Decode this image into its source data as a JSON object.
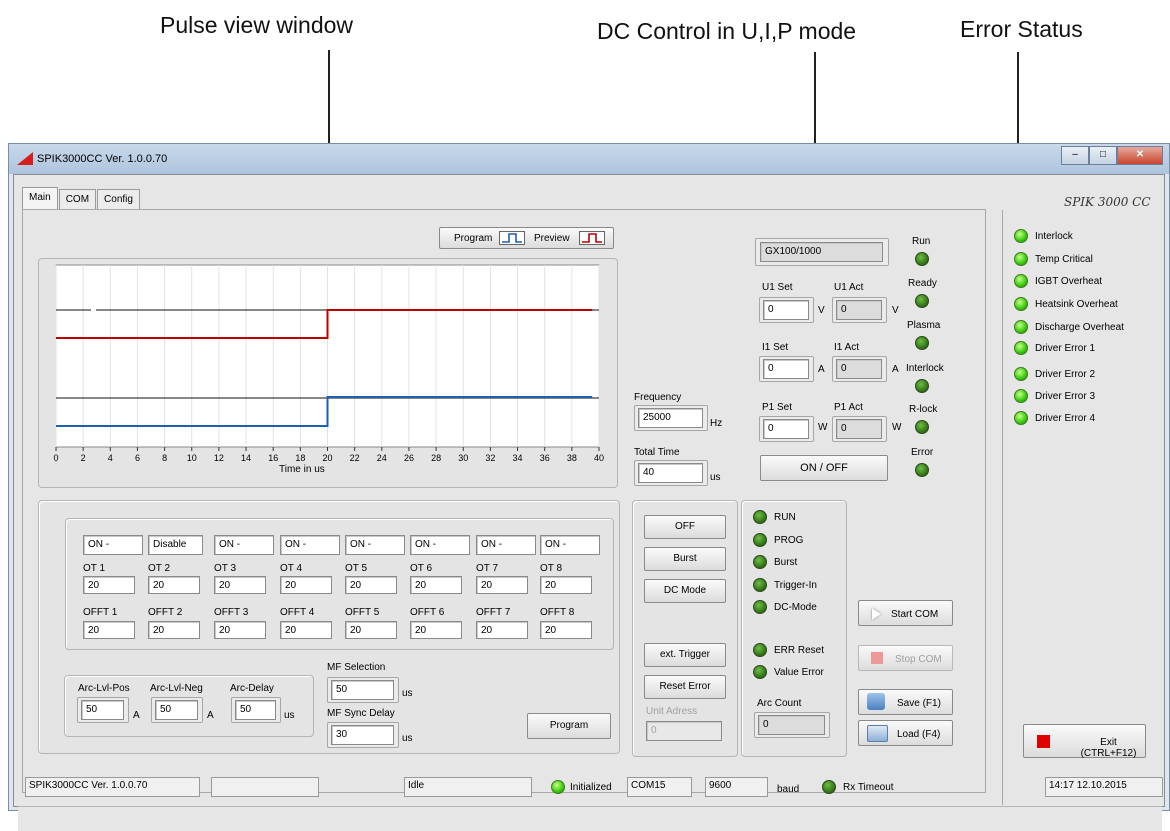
{
  "callouts": {
    "pulse": "Pulse view window",
    "dc": "DC Control in U,I,P mode",
    "error": "Error Status"
  },
  "window": {
    "title": "SPIK3000CC Ver. 1.0.0.70",
    "brand": "SPIK 3000 CC"
  },
  "tabs": [
    "Main",
    "COM",
    "Config"
  ],
  "legend": {
    "program": "Program",
    "preview": "Preview"
  },
  "chart_data": {
    "type": "line",
    "xlabel": "Time in us",
    "xlim": [
      0,
      40
    ],
    "xticks": [
      0,
      2,
      4,
      6,
      8,
      10,
      12,
      14,
      16,
      18,
      20,
      22,
      24,
      26,
      28,
      30,
      32,
      34,
      36,
      38,
      40
    ],
    "series": [
      {
        "name": "Program",
        "color": "#c00000",
        "x": [
          0,
          20,
          20,
          39.5
        ],
        "y": [
          0,
          0,
          1,
          1
        ]
      },
      {
        "name": "Program",
        "color": "#1f5fb0",
        "x": [
          0,
          20,
          20,
          39.5
        ],
        "y": [
          0,
          0,
          1,
          1
        ]
      }
    ]
  },
  "frequency": {
    "label": "Frequency",
    "value": "25000",
    "unit": "Hz"
  },
  "total_time": {
    "label": "Total Time",
    "value": "40",
    "unit": "us"
  },
  "ot_table": {
    "modes": [
      "ON -",
      "Disable",
      "ON -",
      "ON -",
      "ON -",
      "ON -",
      "ON -",
      "ON -"
    ],
    "ot_labels": [
      "OT 1",
      "OT 2",
      "OT 3",
      "OT 4",
      "OT 5",
      "OT 6",
      "OT 7",
      "OT 8"
    ],
    "ot_values": [
      "20",
      "20",
      "20",
      "20",
      "20",
      "20",
      "20",
      "20"
    ],
    "offt_labels": [
      "OFFT 1",
      "OFFT 2",
      "OFFT 3",
      "OFFT 4",
      "OFFT 5",
      "OFFT 6",
      "OFFT 7",
      "OFFT 8"
    ],
    "offt_values": [
      "20",
      "20",
      "20",
      "20",
      "20",
      "20",
      "20",
      "20"
    ]
  },
  "arc": {
    "pos_label": "Arc-Lvl-Pos",
    "pos_value": "50",
    "pos_unit": "A",
    "neg_label": "Arc-Lvl-Neg",
    "neg_value": "50",
    "neg_unit": "A",
    "delay_label": "Arc-Delay",
    "delay_value": "50",
    "delay_unit": "us"
  },
  "mf": {
    "sel_label": "MF Selection",
    "sel_value": "50",
    "sel_unit": "us",
    "sync_label": "MF Sync Delay",
    "sync_value": "30",
    "sync_unit": "us"
  },
  "program_button": "Program",
  "mode_buttons": {
    "off": "OFF",
    "burst": "Burst",
    "dc": "DC Mode",
    "ext": "ext. Trigger",
    "reset": "Reset Error"
  },
  "unit_address": {
    "label": "Unit Adress",
    "value": "0"
  },
  "dc": {
    "model": "GX100/1000",
    "u1_set": "U1 Set",
    "u1_act": "U1 Act",
    "u1_set_v": "0",
    "u1_act_v": "0",
    "u_unit": "V",
    "i1_set": "I1 Set",
    "i1_act": "I1 Act",
    "i1_set_v": "0",
    "i1_act_v": "0",
    "i_unit": "A",
    "p1_set": "P1 Set",
    "p1_act": "P1 Act",
    "p1_set_v": "0",
    "p1_act_v": "0",
    "p_unit": "W",
    "onoff": "ON / OFF"
  },
  "status_leds": [
    "Run",
    "Ready",
    "Plasma",
    "Interlock",
    "R-lock",
    "Error"
  ],
  "run_leds": [
    "RUN",
    "PROG",
    "Burst",
    "Trigger-In",
    "DC-Mode"
  ],
  "err_leds": [
    "ERR Reset",
    "Value Error"
  ],
  "arc_count": {
    "label": "Arc Count",
    "value": "0"
  },
  "com_buttons": {
    "start": "Start COM",
    "stop": "Stop COM",
    "save": "Save (F1)",
    "load": "Load (F4)"
  },
  "error_list": [
    "Interlock",
    "Temp Critical",
    "IGBT Overheat",
    "Heatsink Overheat",
    "Discharge Overheat",
    "Driver Error 1",
    "Driver Error 2",
    "Driver Error 3",
    "Driver Error 4"
  ],
  "exit_button": "Exit (CTRL+F12)",
  "statusbar": {
    "version": "SPIK3000CC Ver. 1.0.0.70",
    "state": "Idle",
    "init": "Initialized",
    "port": "COM15",
    "baud_value": "9600",
    "baud_label": "baud",
    "rx": "Rx Timeout",
    "datetime": "14:17 12.10.2015"
  }
}
